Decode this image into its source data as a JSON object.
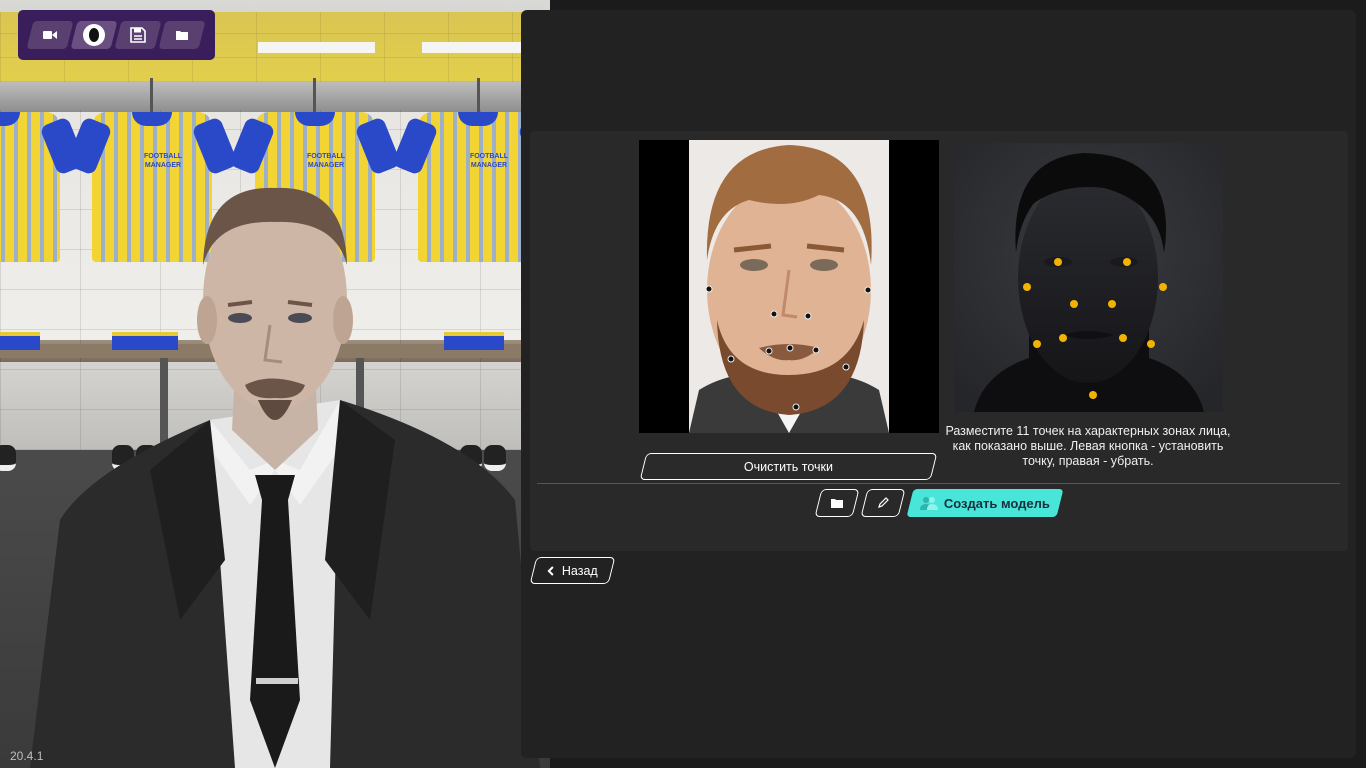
{
  "version": "20.4.1",
  "toolbar": {
    "items": [
      {
        "name": "camera",
        "icon": "video-camera-icon"
      },
      {
        "name": "face",
        "icon": "head-silhouette-icon"
      },
      {
        "name": "save",
        "icon": "floppy-disk-icon"
      },
      {
        "name": "open",
        "icon": "folder-icon"
      }
    ]
  },
  "scene": {
    "shirt_crest_line1": "FOOTBALL",
    "shirt_crest_line2": "MANAGER"
  },
  "face_editor": {
    "instructions": "Разместите 11 точек на характерных зонах лица, как показано выше. Левая кнопка - установить точку, правая - убрать.",
    "clear_points_label": "Очистить точки",
    "create_model_label": "Создать модель",
    "back_label": "Назад"
  },
  "colors": {
    "accent": "#47e6d8",
    "toolbar_bg": "#3a1d5b",
    "guide_dot": "#f2b400",
    "panel_bg": "#222222"
  }
}
